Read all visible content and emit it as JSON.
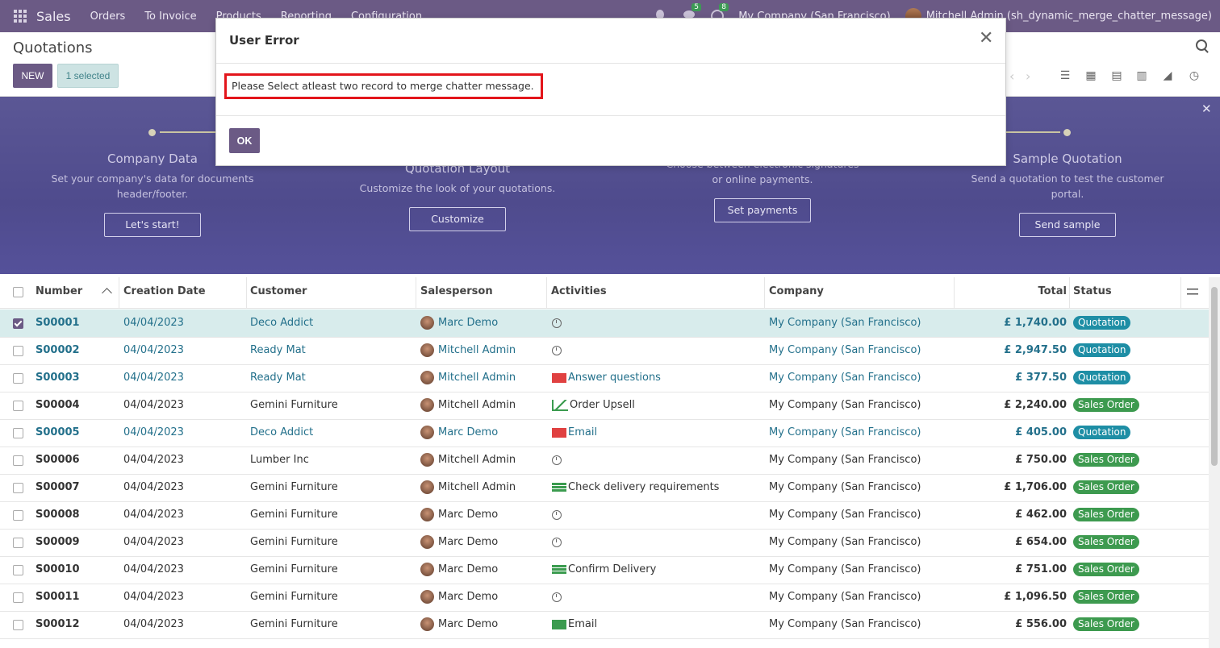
{
  "navbar": {
    "brand": "Sales",
    "menu": [
      "Orders",
      "To Invoice",
      "Products",
      "Reporting",
      "Configuration"
    ],
    "messages_count": "5",
    "activities_count": "8",
    "company": "My Company (San Francisco)",
    "user": "Mitchell Admin (sh_dynamic_merge_chatter_message)"
  },
  "control_panel": {
    "title": "Quotations",
    "new_label": "NEW",
    "selected_label": "1 selected"
  },
  "banner": {
    "steps": [
      {
        "title": "Company Data",
        "desc1": "Set your company's data for documents",
        "desc2": "header/footer.",
        "button": "Let's start!"
      },
      {
        "title": "Quotation Layout",
        "desc1": "Customize the look of your quotations.",
        "desc2": "",
        "button": "Customize"
      },
      {
        "title": "",
        "desc1": "Choose between electronic signatures",
        "desc2": "or online payments.",
        "button": "Set payments"
      },
      {
        "title": "Sample Quotation",
        "desc1": "Send a quotation to test the customer",
        "desc2": "portal.",
        "button": "Send sample"
      }
    ]
  },
  "table": {
    "headers": {
      "number": "Number",
      "creation_date": "Creation Date",
      "customer": "Customer",
      "salesperson": "Salesperson",
      "activities": "Activities",
      "company": "Company",
      "total": "Total",
      "status": "Status"
    },
    "rows": [
      {
        "number": "S00001",
        "date": "04/04/2023",
        "customer": "Deco Addict",
        "salesperson": "Marc Demo",
        "activity": "",
        "activity_icon": "clock",
        "company": "My Company (San Francisco)",
        "total": "£ 1,740.00",
        "status": "Quotation"
      },
      {
        "number": "S00002",
        "date": "04/04/2023",
        "customer": "Ready Mat",
        "salesperson": "Mitchell Admin",
        "activity": "",
        "activity_icon": "clock",
        "company": "My Company (San Francisco)",
        "total": "£ 2,947.50",
        "status": "Quotation"
      },
      {
        "number": "S00003",
        "date": "04/04/2023",
        "customer": "Ready Mat",
        "salesperson": "Mitchell Admin",
        "activity": "Answer questions",
        "activity_icon": "mail-red",
        "company": "My Company (San Francisco)",
        "total": "£ 377.50",
        "status": "Quotation"
      },
      {
        "number": "S00004",
        "date": "04/04/2023",
        "customer": "Gemini Furniture",
        "salesperson": "Mitchell Admin",
        "activity": "Order Upsell",
        "activity_icon": "chart-green",
        "company": "My Company (San Francisco)",
        "total": "£ 2,240.00",
        "status": "Sales Order"
      },
      {
        "number": "S00005",
        "date": "04/04/2023",
        "customer": "Deco Addict",
        "salesperson": "Marc Demo",
        "activity": "Email",
        "activity_icon": "mail-red",
        "company": "My Company (San Francisco)",
        "total": "£ 405.00",
        "status": "Quotation"
      },
      {
        "number": "S00006",
        "date": "04/04/2023",
        "customer": "Lumber Inc",
        "salesperson": "Mitchell Admin",
        "activity": "",
        "activity_icon": "clock",
        "company": "My Company (San Francisco)",
        "total": "£ 750.00",
        "status": "Sales Order"
      },
      {
        "number": "S00007",
        "date": "04/04/2023",
        "customer": "Gemini Furniture",
        "salesperson": "Mitchell Admin",
        "activity": "Check delivery requirements",
        "activity_icon": "tasks-green",
        "company": "My Company (San Francisco)",
        "total": "£ 1,706.00",
        "status": "Sales Order"
      },
      {
        "number": "S00008",
        "date": "04/04/2023",
        "customer": "Gemini Furniture",
        "salesperson": "Marc Demo",
        "activity": "",
        "activity_icon": "clock",
        "company": "My Company (San Francisco)",
        "total": "£ 462.00",
        "status": "Sales Order"
      },
      {
        "number": "S00009",
        "date": "04/04/2023",
        "customer": "Gemini Furniture",
        "salesperson": "Marc Demo",
        "activity": "",
        "activity_icon": "clock",
        "company": "My Company (San Francisco)",
        "total": "£ 654.00",
        "status": "Sales Order"
      },
      {
        "number": "S00010",
        "date": "04/04/2023",
        "customer": "Gemini Furniture",
        "salesperson": "Marc Demo",
        "activity": "Confirm Delivery",
        "activity_icon": "tasks-green",
        "company": "My Company (San Francisco)",
        "total": "£ 751.00",
        "status": "Sales Order"
      },
      {
        "number": "S00011",
        "date": "04/04/2023",
        "customer": "Gemini Furniture",
        "salesperson": "Marc Demo",
        "activity": "",
        "activity_icon": "clock",
        "company": "My Company (San Francisco)",
        "total": "£ 1,096.50",
        "status": "Sales Order"
      },
      {
        "number": "S00012",
        "date": "04/04/2023",
        "customer": "Gemini Furniture",
        "salesperson": "Marc Demo",
        "activity": "Email",
        "activity_icon": "mail-green",
        "company": "My Company (San Francisco)",
        "total": "£ 556.00",
        "status": "Sales Order"
      }
    ]
  },
  "modal": {
    "title": "User Error",
    "message": "Please Select atleast two record to merge chatter message.",
    "ok_label": "OK"
  }
}
